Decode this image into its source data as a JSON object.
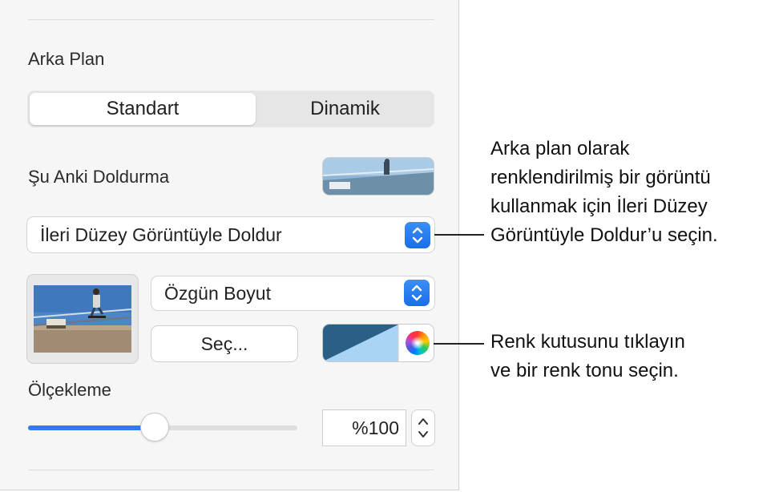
{
  "panel": {
    "section_title": "Arka Plan",
    "segments": {
      "standard": "Standart",
      "dynamic": "Dinamik",
      "selected": "Standart"
    },
    "current_fill_label": "Şu Anki Doldurma",
    "fill_type": "İleri Düzey Görüntüyle Doldur",
    "size_mode": "Özgün Boyut",
    "choose_button": "Seç...",
    "scale_label": "Ölçekleme",
    "scale_value": "%100",
    "scale_fraction": 0.47,
    "tint_colors": {
      "dark": "#2c5f86",
      "light": "#a9d4f4"
    }
  },
  "callouts": {
    "fill": {
      "lines": [
        "Arka plan olarak",
        "renklendirilmiş bir görüntü",
        "kullanmak için İleri Düzey",
        "Görüntüyle Doldur’u seçin."
      ]
    },
    "color": {
      "lines": [
        "Renk kutusunu tıklayın",
        "ve bir renk tonu seçin."
      ]
    }
  }
}
